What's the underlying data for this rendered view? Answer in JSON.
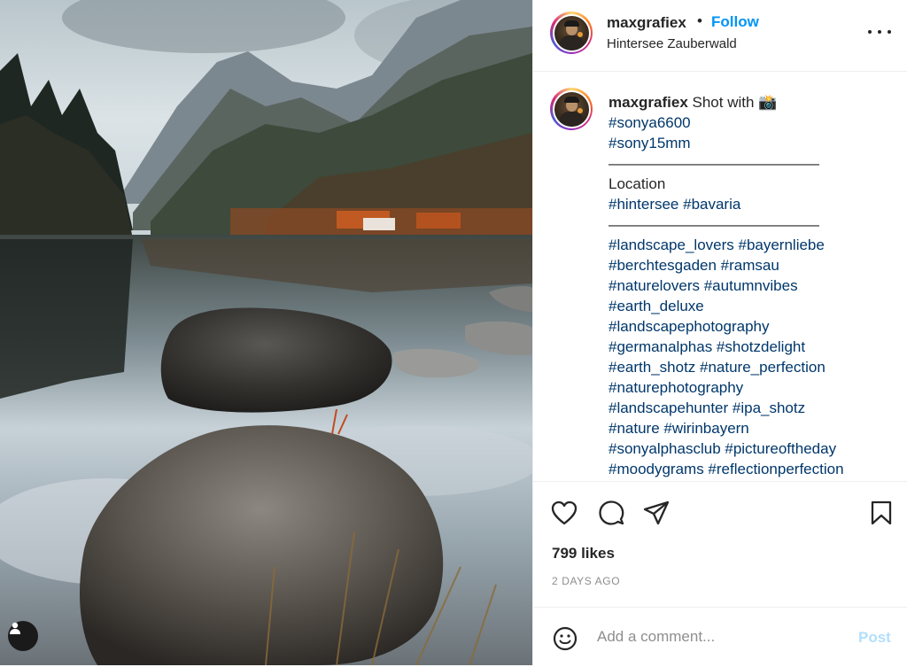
{
  "header": {
    "username": "maxgrafiex",
    "separator": "•",
    "follow_label": "Follow",
    "location": "Hintersee Zauberwald",
    "more_icon": "more-horizontal-icon"
  },
  "photo": {
    "tag_button_icon": "user-tag-icon"
  },
  "caption": {
    "username": "maxgrafiex",
    "text": "Shot with 📸",
    "lines": [
      {
        "text": "#sonya6600",
        "is_tag": true
      },
      {
        "text": "#sony15mm",
        "is_tag": true
      },
      {
        "text": "——————————————",
        "is_tag": false
      },
      {
        "text": "Location",
        "is_tag": false
      },
      {
        "text": "#hintersee #bavaria",
        "is_tag": true
      },
      {
        "text": "——————————————",
        "is_tag": false
      },
      {
        "text": "#landscape_lovers #bayernliebe",
        "is_tag": true
      },
      {
        "text": "#berchtesgaden #ramsau",
        "is_tag": true
      },
      {
        "text": "#naturelovers #autumnvibes",
        "is_tag": true
      },
      {
        "text": "#earth_deluxe",
        "is_tag": true
      },
      {
        "text": "#landscapephotography",
        "is_tag": true
      },
      {
        "text": "#germanalphas #shotzdelight",
        "is_tag": true
      },
      {
        "text": "#earth_shotz #nature_perfection",
        "is_tag": true
      },
      {
        "text": "#naturephotography",
        "is_tag": true
      },
      {
        "text": "#landscapehunter #ipa_shotz",
        "is_tag": true
      },
      {
        "text": "#nature #wirinbayern",
        "is_tag": true
      },
      {
        "text": "#sonyalphasclub #pictureoftheday",
        "is_tag": true
      },
      {
        "text": "#moodygrams #reflectionperfection",
        "is_tag": true
      }
    ]
  },
  "actions": {
    "like_icon": "heart-icon",
    "comment_icon": "comment-icon",
    "share_icon": "paper-plane-icon",
    "save_icon": "bookmark-icon",
    "likes": "799 likes",
    "time_ago": "2 DAYS AGO"
  },
  "add_comment": {
    "emoji_icon": "smiley-icon",
    "placeholder": "Add a comment...",
    "post_label": "Post"
  },
  "colors": {
    "follow": "#0095f6",
    "hashtag": "#00376b",
    "post_disabled": "#b2dffc",
    "muted": "#8e8e8e",
    "text": "#262626"
  }
}
